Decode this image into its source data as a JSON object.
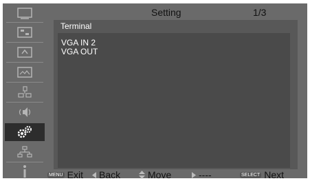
{
  "header": {
    "title": "Setting",
    "page": "1/3"
  },
  "sidebar": {
    "items": [
      {
        "icon": "display-icon",
        "active": false
      },
      {
        "icon": "picture-adjust-icon",
        "active": false
      },
      {
        "icon": "screen-icon",
        "active": false
      },
      {
        "icon": "image-icon",
        "active": false
      },
      {
        "icon": "computer-icon",
        "active": false
      },
      {
        "icon": "sound-icon",
        "active": false
      },
      {
        "icon": "settings-gears-icon",
        "active": true
      },
      {
        "icon": "network-icon",
        "active": false
      },
      {
        "icon": "info-icon",
        "active": false
      }
    ]
  },
  "panel": {
    "title": "Terminal",
    "items": [
      "VGA IN 2",
      "VGA OUT"
    ]
  },
  "footer": {
    "menu_key": "MENU",
    "exit_label": "Exit",
    "back_label": "Back",
    "move_label": "Move",
    "right_label": "----",
    "select_key": "SELECT",
    "next_label": "Next"
  },
  "colors": {
    "frame": "#6a6a6a",
    "panel": "#585858",
    "list": "#4a4a4a",
    "active_item": "#2d2d2d"
  }
}
